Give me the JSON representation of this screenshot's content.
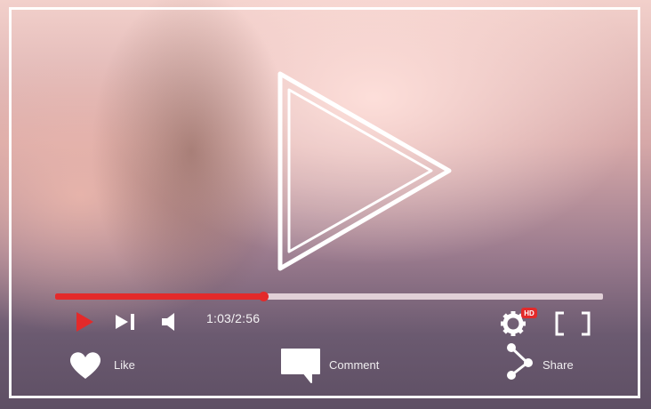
{
  "player": {
    "time_display": "1:03/2:56",
    "progress": 0.38,
    "accent_color": "#e32a2a"
  },
  "controls": {
    "play_icon": "play-icon",
    "next_icon": "skip-next-icon",
    "volume_icon": "volume-icon",
    "settings_icon": "settings-gear-icon",
    "settings_badge": "HD",
    "fullscreen_icon": "fullscreen-icon"
  },
  "actions": {
    "like_label": "Like",
    "comment_label": "Comment",
    "share_label": "Share"
  }
}
